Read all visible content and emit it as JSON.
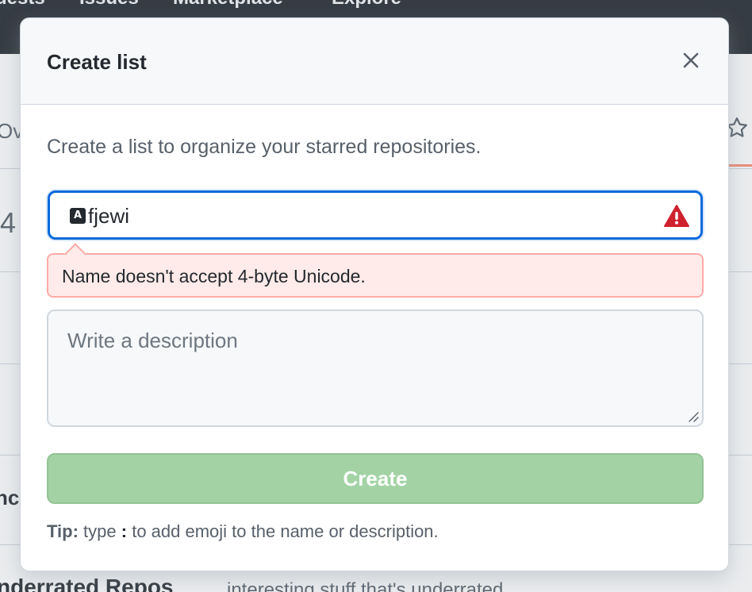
{
  "background": {
    "nav_items": [
      "uests",
      "Issues",
      "Marketplace",
      "Explore"
    ],
    "left_fragments": [
      "Ov",
      "4",
      "nc"
    ],
    "bottom_list_title": "nderrated Repos",
    "bottom_list_description": "interesting stuff that's underrated"
  },
  "modal": {
    "title": "Create list",
    "close_icon": "x-icon",
    "intro": "Create a list to organize your starred repositories.",
    "name_field": {
      "glyph": "A",
      "value": "fjewi",
      "status_icon": "alert-triangle-icon"
    },
    "error_message": "Name doesn't accept 4-byte Unicode.",
    "description_field": {
      "placeholder": "Write a description",
      "value": ""
    },
    "create_label": "Create",
    "tip": {
      "label": "Tip:",
      "before": "type",
      "key": ":",
      "after": "to add emoji to the name or description."
    }
  },
  "colors": {
    "accent_blue": "#0969da",
    "danger_red": "#cf222e",
    "error_background": "#ffebe9",
    "disabled_green": "#a3d3a5"
  }
}
